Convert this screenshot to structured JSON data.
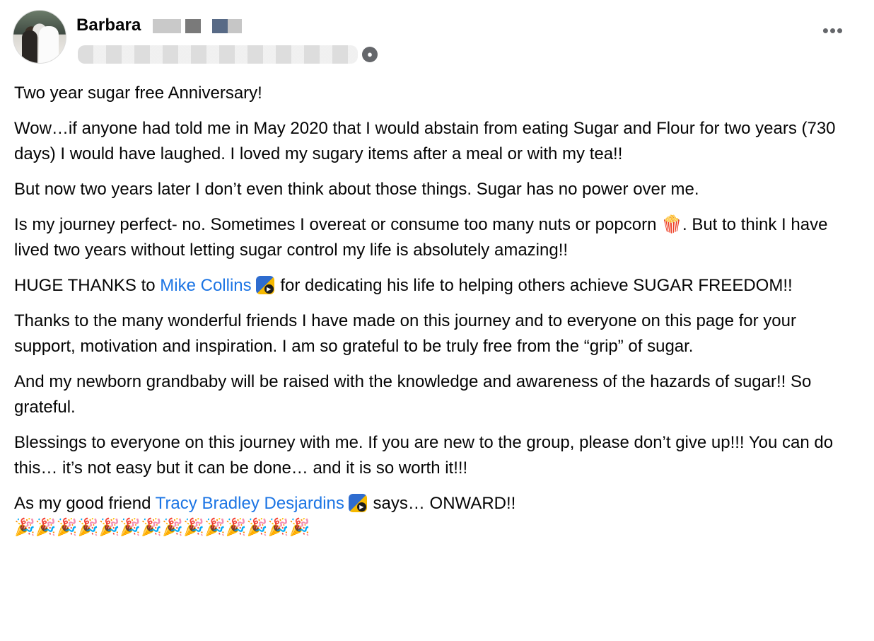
{
  "header": {
    "author_first_name": "Barbara",
    "more_label": "•••",
    "audience_icon": "group-icon"
  },
  "paragraphs": {
    "p1": "Two year sugar free Anniversary!",
    "p2": "Wow…if anyone had told me in May 2020 that I would abstain from eating Sugar and Flour for two years (730 days) I would have laughed. I loved my sugary items after a meal or with my tea!!",
    "p3": "But now two years later I don’t even think about those things.  Sugar has no power over me.",
    "p4_before": "Is my journey perfect- no. Sometimes I overeat or consume too many nuts or popcorn ",
    "p4_emoji": "🍿",
    "p4_after": ". But to think I have lived two years without letting sugar control my life is absolutely amazing!!",
    "p5_before": "HUGE THANKS to ",
    "p5_link": "Mike Collins",
    "p5_after": " for dedicating his life to helping others achieve SUGAR FREEDOM!!",
    "p6": "Thanks to the many wonderful friends I have made on this journey and to everyone on this page for your support, motivation and inspiration. I am so grateful to be truly free from the “grip” of sugar.",
    "p7": "And my newborn grandbaby will be raised with the knowledge and awareness of the hazards of sugar!! So grateful.",
    "p8": "Blessings to everyone on this journey with me. If you are new to the group, please don’t give up!!! You can do this… it’s not easy but it can be done… and it is so worth it!!!",
    "p9_before": "As my good friend ",
    "p9_link": "Tracy Bradley Desjardins",
    "p9_after": " says… ONWARD!!",
    "confetti": "🎉🎉🎉🎉🎉🎉🎉🎉🎉🎉🎉🎉🎉🎉"
  },
  "icons": {
    "badge": "community-badge-icon",
    "popcorn": "popcorn-emoji",
    "confetti": "party-popper-emoji"
  },
  "colors": {
    "link": "#1b74e4",
    "text": "#050505",
    "muted": "#65676b"
  }
}
